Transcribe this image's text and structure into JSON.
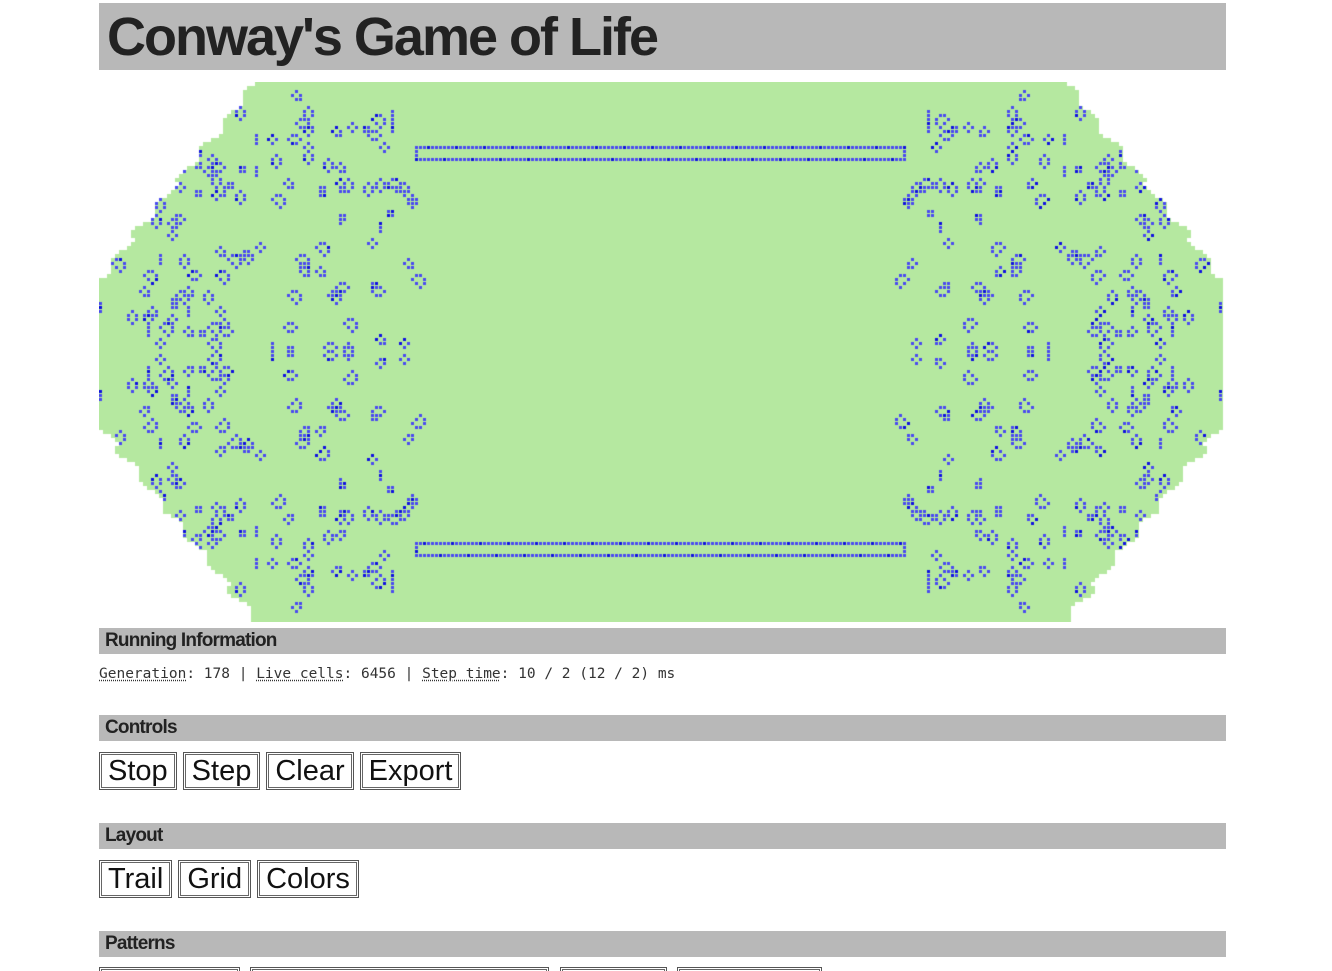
{
  "header": {
    "title": "Conway's Game of Life"
  },
  "board": {
    "background_color": "#ffffff",
    "area_color": "#b5e8a0",
    "live_cell_color": "#4a4af0",
    "dense_cell_color": "#1010e0"
  },
  "running_info": {
    "heading": "Running Information",
    "generation_label": "Generation",
    "generation_value": "178",
    "live_cells_label": "Live cells",
    "live_cells_value": "6456",
    "step_time_label": "Step time",
    "step_time_value": "10 / 2 (12 / 2) ms",
    "separator": " | "
  },
  "controls": {
    "heading": "Controls",
    "buttons": [
      "Stop",
      "Step",
      "Clear",
      "Export"
    ]
  },
  "layout": {
    "heading": "Layout",
    "buttons": [
      "Trail",
      "Grid",
      "Colors"
    ]
  },
  "patterns": {
    "heading": "Patterns"
  }
}
